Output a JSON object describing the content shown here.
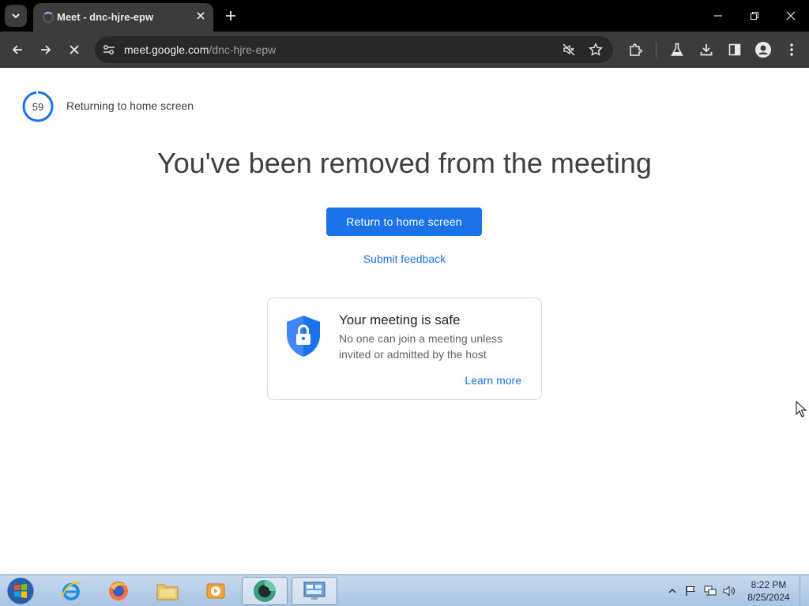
{
  "browser": {
    "tab_title": "Meet - dnc-hjre-epw",
    "url_host": "meet.google.com",
    "url_path": "/dnc-hjre-epw"
  },
  "page": {
    "countdown_value": "59",
    "countdown_label": "Returning to home screen",
    "headline": "You've been removed from the meeting",
    "primary_button": "Return to home screen",
    "feedback_link": "Submit feedback",
    "card": {
      "title": "Your meeting is safe",
      "body": "No one can join a meeting unless invited or admitted by the host",
      "link": "Learn more"
    }
  },
  "taskbar": {
    "time": "8:22 PM",
    "date": "8/25/2024"
  },
  "colors": {
    "accent": "#1a73e8",
    "shield": "#4285f4",
    "chrome_dark": "#3c3c3c"
  }
}
